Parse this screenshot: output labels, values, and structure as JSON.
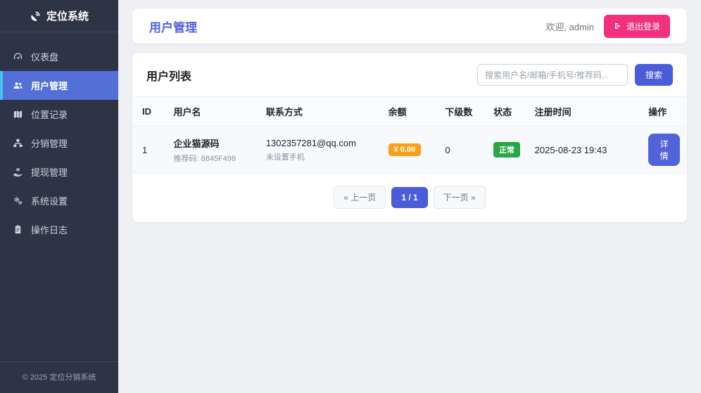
{
  "app": {
    "logo_text": "定位系统",
    "footer": "© 2025 定位分销系统"
  },
  "sidebar": {
    "items": [
      {
        "label": "仪表盘",
        "icon": "dashboard-icon",
        "active": false
      },
      {
        "label": "用户管理",
        "icon": "users-icon",
        "active": true
      },
      {
        "label": "位置记录",
        "icon": "map-icon",
        "active": false
      },
      {
        "label": "分销管理",
        "icon": "sitemap-icon",
        "active": false
      },
      {
        "label": "提现管理",
        "icon": "withdraw-icon",
        "active": false
      },
      {
        "label": "系统设置",
        "icon": "settings-icon",
        "active": false
      },
      {
        "label": "操作日志",
        "icon": "logs-icon",
        "active": false
      }
    ]
  },
  "header": {
    "title": "用户管理",
    "welcome": "欢迎, admin",
    "logout_label": "退出登录"
  },
  "panel": {
    "title": "用户列表",
    "search_placeholder": "搜索用户名/邮箱/手机号/推荐码...",
    "search_button": "搜索"
  },
  "table": {
    "columns": [
      "ID",
      "用户名",
      "联系方式",
      "余额",
      "下级数",
      "状态",
      "注册时间",
      "操作"
    ],
    "rows": [
      {
        "id": "1",
        "username": "企业猫源码",
        "referral": "推荐码: 8845F498",
        "email": "1302357281@qq.com",
        "phone": "未设置手机",
        "balance": "¥ 0.00",
        "subordinates": "0",
        "status": "正常",
        "registered": "2025-08-23 19:43",
        "action": "详情"
      }
    ]
  },
  "pagination": {
    "prev": "« 上一页",
    "current": "1 / 1",
    "next": "下一页 »"
  },
  "colors": {
    "sidebar_bg": "#2d3446",
    "sidebar_active": "#5470d6",
    "active_border": "#41c4f0",
    "primary_blue": "#4a5cd8",
    "title_blue": "#5262e2",
    "logout_pink": "#f1307e",
    "balance_orange": "#f9a11b",
    "status_green": "#28a745"
  }
}
